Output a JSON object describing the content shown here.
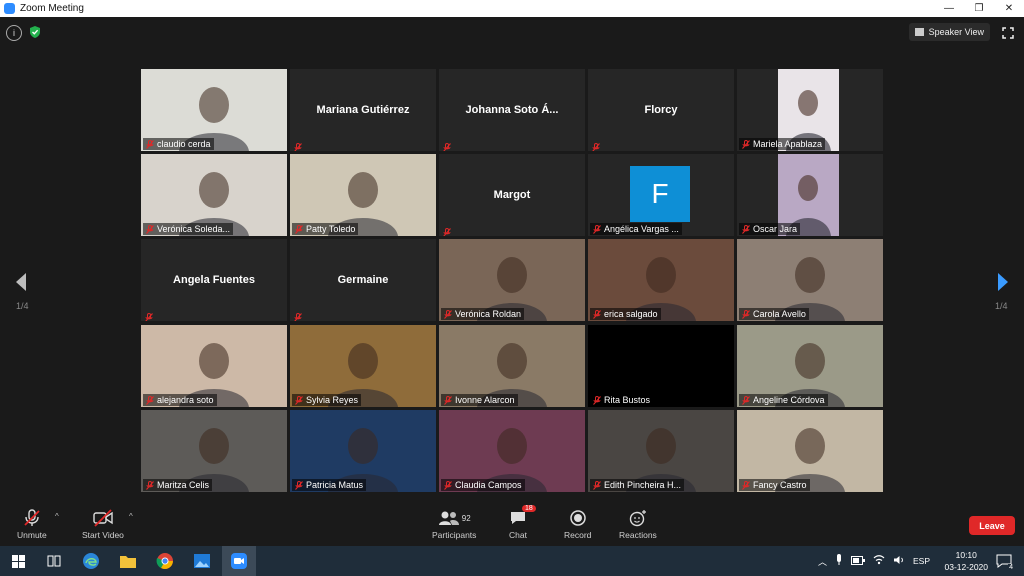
{
  "window": {
    "title": "Zoom Meeting",
    "min_glyph": "—",
    "restore_glyph": "❐",
    "close_glyph": "✕"
  },
  "top_bar": {
    "speaker_view_label": "Speaker View"
  },
  "pagination": {
    "left_indicator": "1/4",
    "right_indicator": "1/4"
  },
  "participants": [
    {
      "name": "claudio cerda",
      "type": "video",
      "active": true,
      "bg": "#dcdcd6"
    },
    {
      "name": "Mariana Gutiérrez",
      "type": "name"
    },
    {
      "name": "Johanna Soto Á...",
      "type": "name"
    },
    {
      "name": "Florcy",
      "type": "name"
    },
    {
      "name": "Mariela Apablaza",
      "type": "video-small",
      "bg": "#e9e4e8"
    },
    {
      "name": "Verónica Soleda...",
      "type": "video",
      "bg": "#d8d3cc"
    },
    {
      "name": "Patty Toledo",
      "type": "video",
      "bg": "#cfc7b5"
    },
    {
      "name": "Margot",
      "type": "name"
    },
    {
      "name": "Angélica Vargas ...",
      "type": "avatar",
      "avatar_letter": "F",
      "avatar_color": "#0e8fd6"
    },
    {
      "name": "Oscar Jara",
      "type": "video-small",
      "bg": "#b9a8c4"
    },
    {
      "name": "Angela Fuentes",
      "type": "name"
    },
    {
      "name": "Germaine",
      "type": "name"
    },
    {
      "name": "Verónica Roldan",
      "type": "video",
      "bg": "#7a6657"
    },
    {
      "name": "erica salgado",
      "type": "video",
      "bg": "#6b4b3c"
    },
    {
      "name": "Carola Avello",
      "type": "video",
      "bg": "#8d7f74"
    },
    {
      "name": "alejandra soto",
      "type": "video",
      "bg": "#cdb9a7"
    },
    {
      "name": "Sylvia Reyes",
      "type": "video",
      "bg": "#8f6c3a"
    },
    {
      "name": "Ivonne Alarcon",
      "type": "video",
      "bg": "#8a7a66"
    },
    {
      "name": "Rita Bustos",
      "type": "black"
    },
    {
      "name": "Angeline Córdova",
      "type": "video",
      "bg": "#9b9a88"
    },
    {
      "name": "Maritza Celis",
      "type": "video",
      "bg": "#5d5b58"
    },
    {
      "name": "Patricia Matus",
      "type": "video",
      "bg": "#1f3b63"
    },
    {
      "name": "Claudia Campos",
      "type": "video",
      "bg": "#6e3b52"
    },
    {
      "name": "Edith Pincheira H...",
      "type": "video",
      "bg": "#4a4643"
    },
    {
      "name": "Fancy Castro",
      "type": "video",
      "bg": "#c2b7a4"
    }
  ],
  "toolbar": {
    "unmute_label": "Unmute",
    "start_video_label": "Start Video",
    "participants_label": "Participants",
    "participants_count": "92",
    "chat_label": "Chat",
    "chat_badge": "18",
    "record_label": "Record",
    "reactions_label": "Reactions",
    "leave_label": "Leave",
    "caret": "^"
  },
  "taskbar": {
    "language": "ESP",
    "time": "10:10",
    "date": "03-12-2020",
    "notification_count": "4"
  },
  "icons": {
    "info": "info-icon",
    "security": "shield-icon",
    "mute": "muted-mic-icon",
    "video_off": "video-off-icon"
  },
  "colors": {
    "active_speaker_border": "#b7e24b",
    "leave_button": "#e02828",
    "muted_red": "#e02828",
    "zoom_blue": "#2d8cff",
    "nav_arrow_blue": "#3a9bff"
  }
}
